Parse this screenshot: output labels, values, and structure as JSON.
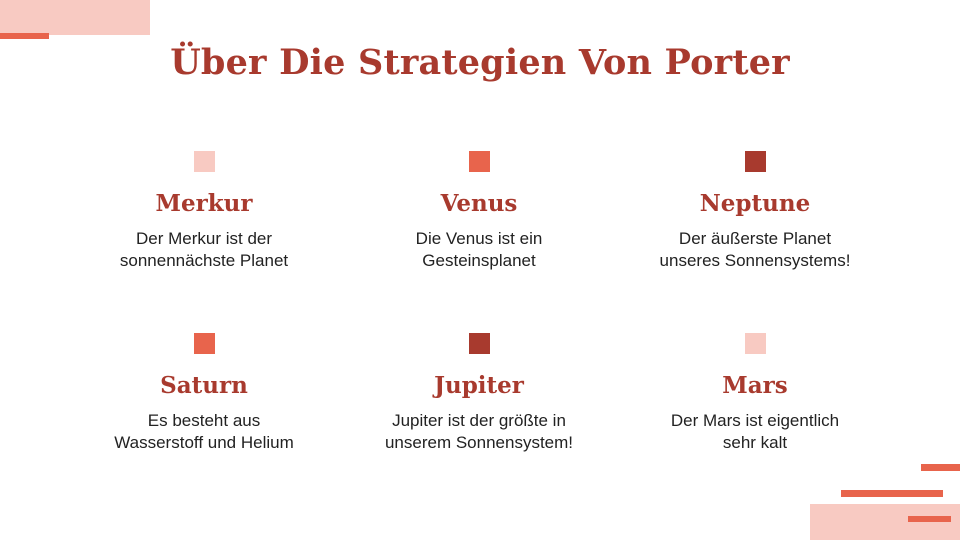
{
  "colors": {
    "title": "#a83a2e",
    "light": "#f8cac2",
    "medium": "#e8644c",
    "dark": "#a83a2e"
  },
  "page": {
    "title": "Über Die Strategien Von Porter"
  },
  "items": [
    {
      "title": "Merkur",
      "description": "Der Merkur ist der\nsonnennächste Planet",
      "square_color": "#f8cac2"
    },
    {
      "title": "Venus",
      "description": "Die Venus ist ein\nGesteinsplanet",
      "square_color": "#e8644c"
    },
    {
      "title": "Neptune",
      "description": "Der äußerste Planet\nunseres Sonnensystems!",
      "square_color": "#a83a2e"
    },
    {
      "title": "Saturn",
      "description": "Es besteht aus\nWasserstoff und Helium",
      "square_color": "#e8644c"
    },
    {
      "title": "Jupiter",
      "description": "Jupiter ist der größte in\nunserem Sonnensystem!",
      "square_color": "#a83a2e"
    },
    {
      "title": "Mars",
      "description": "Der Mars ist eigentlich\nsehr kalt",
      "square_color": "#f8cac2"
    }
  ]
}
